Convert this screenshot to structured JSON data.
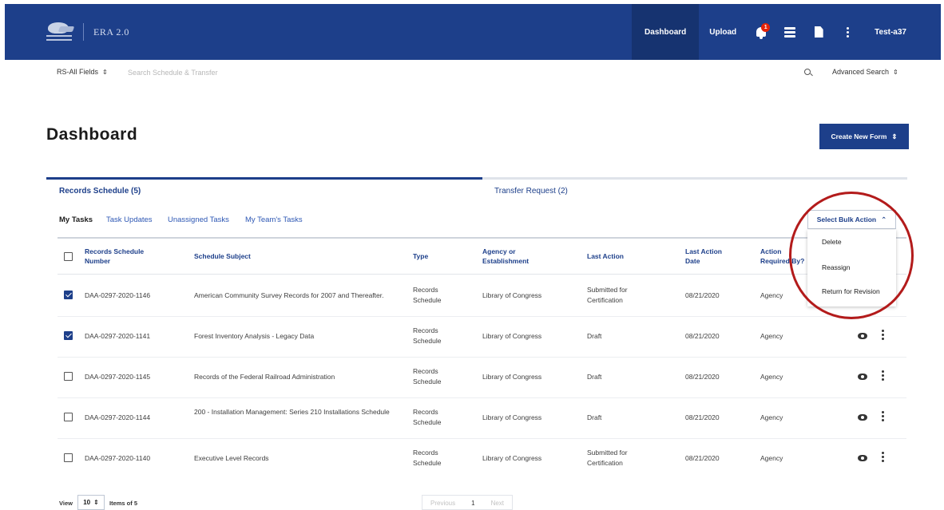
{
  "header": {
    "app_name": "ERA 2.0",
    "nav": {
      "dashboard": "Dashboard",
      "upload": "Upload"
    },
    "notification_count": "1",
    "user": "Test-a37"
  },
  "search": {
    "field_selector": "RS-All Fields",
    "placeholder": "Search Schedule & Transfer",
    "advanced": "Advanced Search"
  },
  "page": {
    "title": "Dashboard",
    "create_button": "Create New Form"
  },
  "tabs": [
    {
      "label": "Records Schedule (5)",
      "active": true
    },
    {
      "label": "Transfer Request (2)",
      "active": false
    }
  ],
  "subtabs": [
    "My Tasks",
    "Task Updates",
    "Unassigned Tasks",
    "My Team's Tasks"
  ],
  "bulk_action": {
    "label": "Select Bulk Action",
    "options": [
      "Delete",
      "Reassign",
      "Return for Revision"
    ]
  },
  "table": {
    "headers": {
      "number": "Records Schedule Number",
      "subject": "Schedule Subject",
      "type": "Type",
      "agency": "Agency or Establishment",
      "last_action": "Last Action",
      "last_action_date": "Last Action Date",
      "action_required": "Action Required By?"
    },
    "rows": [
      {
        "checked": true,
        "number": "DAA-0297-2020-1146",
        "subject": "American Community Survey Records for 2007 and Thereafter.",
        "type": "Records Schedule",
        "agency": "Library of Congress",
        "last_action": "Submitted for Certification",
        "date": "08/21/2020",
        "required_by": "Agency"
      },
      {
        "checked": true,
        "number": "DAA-0297-2020-1141",
        "subject": "Forest Inventory Analysis - Legacy Data",
        "type": "Records Schedule",
        "agency": "Library of Congress",
        "last_action": "Draft",
        "date": "08/21/2020",
        "required_by": "Agency"
      },
      {
        "checked": false,
        "number": "DAA-0297-2020-1145",
        "subject": "Records of the Federal Railroad Administration",
        "type": "Records Schedule",
        "agency": "Library of Congress",
        "last_action": "Draft",
        "date": "08/21/2020",
        "required_by": "Agency"
      },
      {
        "checked": false,
        "number": "DAA-0297-2020-1144",
        "subject": "200 - Installation Management: Series 210 Installations Schedule",
        "type": "Records Schedule",
        "agency": "Library of Congress",
        "last_action": "Draft",
        "date": "08/21/2020",
        "required_by": "Agency"
      },
      {
        "checked": false,
        "number": "DAA-0297-2020-1140",
        "subject": "Executive Level Records",
        "type": "Records Schedule",
        "agency": "Library of Congress",
        "last_action": "Submitted for Certification",
        "date": "08/21/2020",
        "required_by": "Agency"
      }
    ]
  },
  "footer": {
    "view_label": "View",
    "per_page": "10",
    "items_of": "Items of 5",
    "prev": "Previous",
    "page": "1",
    "next": "Next"
  },
  "colors": {
    "brand": "#1d3f8a",
    "annotation": "#b31b1b",
    "alert": "#e52207"
  }
}
